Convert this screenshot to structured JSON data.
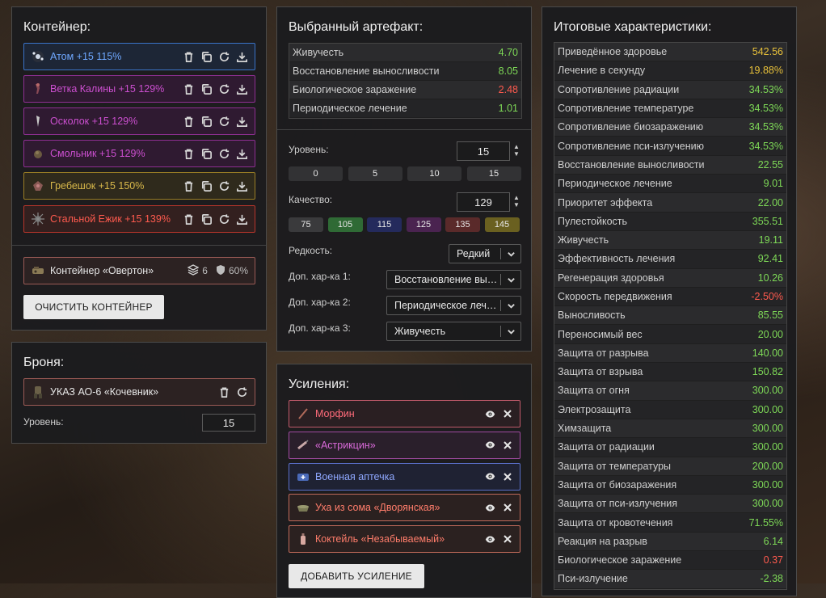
{
  "container": {
    "title": "Контейнер:",
    "items": [
      {
        "name": "Атом +15 115%",
        "color": "#6fa8ff",
        "border": "#3a73c8",
        "bg": "#1d2636"
      },
      {
        "name": "Ветка Калины +15 129%",
        "color": "#cc4fd0",
        "border": "#8e2f92",
        "bg": "#2f1a31"
      },
      {
        "name": "Осколок +15 129%",
        "color": "#cc4fd0",
        "border": "#8e2f92",
        "bg": "#2f1a31"
      },
      {
        "name": "Смольник +15 129%",
        "color": "#cc4fd0",
        "border": "#8e2f92",
        "bg": "#2f1a31"
      },
      {
        "name": "Гребешок +15 150%",
        "color": "#d8b84a",
        "border": "#9a7e25",
        "bg": "#2f2a1c"
      },
      {
        "name": "Стальной Ежик +15 139%",
        "color": "#ff5a4e",
        "border": "#b8352b",
        "bg": "#33201f"
      }
    ],
    "holder": {
      "name": "Контейнер «Овертон»",
      "slots": "6",
      "protection": "60%"
    },
    "clear_label": "ОЧИСТИТЬ КОНТЕЙНЕР"
  },
  "armor": {
    "title": "Броня:",
    "name": "УКАЗ АО-6 «Кочевник»",
    "level_label": "Уровень:",
    "level": "15"
  },
  "artifact": {
    "title": "Выбранный артефакт:",
    "stats": [
      {
        "label": "Живучесть",
        "value": "4.70",
        "color": "#7ed957"
      },
      {
        "label": "Восстановление выносливости",
        "value": "8.05",
        "color": "#7ed957"
      },
      {
        "label": "Биологическое заражение",
        "value": "2.48",
        "color": "#ff5a4e"
      },
      {
        "label": "Периодическое лечение",
        "value": "1.01",
        "color": "#7ed957"
      }
    ],
    "level_label": "Уровень:",
    "level": "15",
    "level_presets": [
      "0",
      "5",
      "10",
      "15"
    ],
    "quality_label": "Качество:",
    "quality": "129",
    "quality_presets": [
      {
        "label": "75",
        "bg": "#3a3a3c"
      },
      {
        "label": "105",
        "bg": "#2f6a35"
      },
      {
        "label": "115",
        "bg": "#242a5c"
      },
      {
        "label": "125",
        "bg": "#4a2350"
      },
      {
        "label": "135",
        "bg": "#5a2a2a"
      },
      {
        "label": "145",
        "bg": "#6a6020"
      }
    ],
    "rarity_label": "Редкость:",
    "rarity": "Редкий",
    "extra1_label": "Доп. хар-ка 1:",
    "extra1": "Восстановление выносливости",
    "extra2_label": "Доп. хар-ка 2:",
    "extra2": "Периодическое лечение",
    "extra3_label": "Доп. хар-ка 3:",
    "extra3": "Живучесть"
  },
  "boosts": {
    "title": "Усиления:",
    "items": [
      {
        "name": "Морфин",
        "color": "#ff6b7a",
        "border": "#c05a6a",
        "bg": "#2a1f22"
      },
      {
        "name": "«Астрикцин»",
        "color": "#d96ad9",
        "border": "#a04aa0",
        "bg": "#2a1f2b"
      },
      {
        "name": "Военная аптечка",
        "color": "#8fa8ff",
        "border": "#5a6fc8",
        "bg": "#1f2233"
      },
      {
        "name": "Уха из сома «Дворянская»",
        "color": "#ff7d6b",
        "border": "#c06a5a",
        "bg": "#2b2120"
      },
      {
        "name": "Коктейль «Незабываемый»",
        "color": "#ff7d6b",
        "border": "#c06a5a",
        "bg": "#2b2120"
      }
    ],
    "add_label": "ДОБАВИТЬ УСИЛЕНИЕ"
  },
  "totals": {
    "title": "Итоговые характеристики:",
    "stats": [
      {
        "label": "Приведённое здоровье",
        "value": "542.56",
        "color": "#e8c13a"
      },
      {
        "label": "Лечение в секунду",
        "value": "19.88%",
        "color": "#e8c13a"
      },
      {
        "label": "Сопротивление радиации",
        "value": "34.53%",
        "color": "#7ed957"
      },
      {
        "label": "Сопротивление температуре",
        "value": "34.53%",
        "color": "#7ed957"
      },
      {
        "label": "Сопротивление биозаражению",
        "value": "34.53%",
        "color": "#7ed957"
      },
      {
        "label": "Сопротивление пси-излучению",
        "value": "34.53%",
        "color": "#7ed957"
      },
      {
        "label": "Восстановление выносливости",
        "value": "22.55",
        "color": "#7ed957"
      },
      {
        "label": "Периодическое лечение",
        "value": "9.01",
        "color": "#7ed957"
      },
      {
        "label": "Приоритет эффекта",
        "value": "22.00",
        "color": "#7ed957"
      },
      {
        "label": "Пулестойкость",
        "value": "355.51",
        "color": "#7ed957"
      },
      {
        "label": "Живучесть",
        "value": "19.11",
        "color": "#7ed957"
      },
      {
        "label": "Эффективность лечения",
        "value": "92.41",
        "color": "#7ed957"
      },
      {
        "label": "Регенерация здоровья",
        "value": "10.26",
        "color": "#7ed957"
      },
      {
        "label": "Скорость передвижения",
        "value": "-2.50%",
        "color": "#ff5a4e"
      },
      {
        "label": "Выносливость",
        "value": "85.55",
        "color": "#7ed957"
      },
      {
        "label": "Переносимый вес",
        "value": "20.00",
        "color": "#7ed957"
      },
      {
        "label": "Защита от разрыва",
        "value": "140.00",
        "color": "#7ed957"
      },
      {
        "label": "Защита от взрыва",
        "value": "150.82",
        "color": "#7ed957"
      },
      {
        "label": "Защита от огня",
        "value": "300.00",
        "color": "#7ed957"
      },
      {
        "label": "Электрозащита",
        "value": "300.00",
        "color": "#7ed957"
      },
      {
        "label": "Химзащита",
        "value": "300.00",
        "color": "#7ed957"
      },
      {
        "label": "Защита от радиации",
        "value": "300.00",
        "color": "#7ed957"
      },
      {
        "label": "Защита от температуры",
        "value": "200.00",
        "color": "#7ed957"
      },
      {
        "label": "Защита от биозаражения",
        "value": "300.00",
        "color": "#7ed957"
      },
      {
        "label": "Защита от пси-излучения",
        "value": "300.00",
        "color": "#7ed957"
      },
      {
        "label": "Защита от кровотечения",
        "value": "71.55%",
        "color": "#7ed957"
      },
      {
        "label": "Реакция на разрыв",
        "value": "6.14",
        "color": "#7ed957"
      },
      {
        "label": "Биологическое заражение",
        "value": "0.37",
        "color": "#ff5a4e"
      },
      {
        "label": "Пси-излучение",
        "value": "-2.38",
        "color": "#7ed957"
      }
    ]
  }
}
